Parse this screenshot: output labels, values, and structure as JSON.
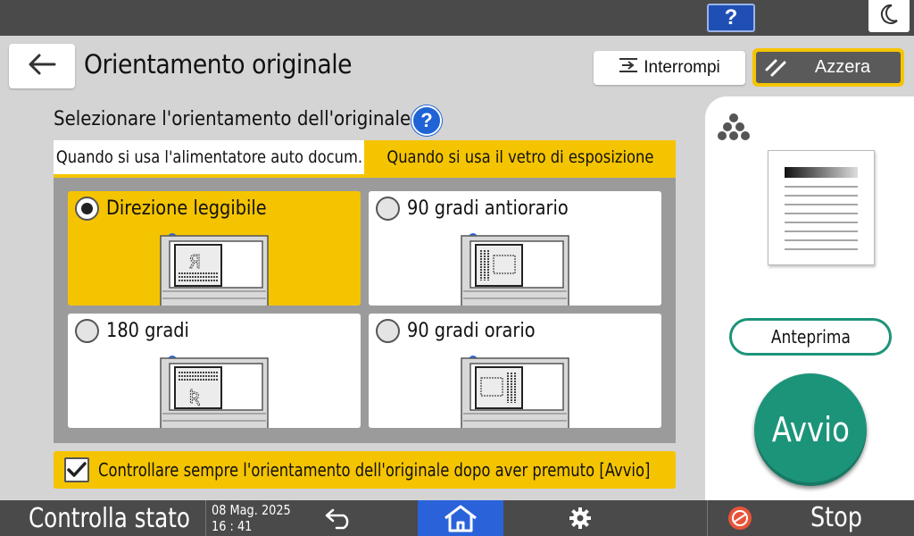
{
  "header": {
    "title": "Orientamento originale",
    "interrupt_label": "Interrompi",
    "reset_label": "Azzera",
    "help_label": "?"
  },
  "instruction": {
    "text": "Selezionare l'orientamento dell'originale.",
    "help_label": "?"
  },
  "tabs": [
    {
      "label": "Quando si usa l'alimentatore auto docum.",
      "selected": false
    },
    {
      "label": "Quando si usa il vetro di esposizione",
      "selected": true
    }
  ],
  "options": [
    {
      "label": "Direzione leggibile",
      "selected": true,
      "icon": "scanner-readable-icon"
    },
    {
      "label": "90 gradi antiorario",
      "selected": false,
      "icon": "scanner-90-ccw-icon"
    },
    {
      "label": "180 gradi",
      "selected": false,
      "icon": "scanner-180-icon"
    },
    {
      "label": "90 gradi orario",
      "selected": false,
      "icon": "scanner-90-cw-icon"
    }
  ],
  "checkbox": {
    "label": "Controllare sempre l'orientamento dell'originale dopo aver premuto [Avvio]",
    "checked": true
  },
  "right": {
    "preview_label": "Anteprima",
    "start_label": "Avvio"
  },
  "bottom": {
    "status_label": "Controlla stato",
    "date": "08 Mag. 2025",
    "time": "16 : 41",
    "stop_label": "Stop"
  },
  "colors": {
    "accent_yellow": "#f5c400",
    "start_green": "#1c9479",
    "home_blue": "#2a63d9",
    "bar_gray": "#4a4a4a"
  }
}
